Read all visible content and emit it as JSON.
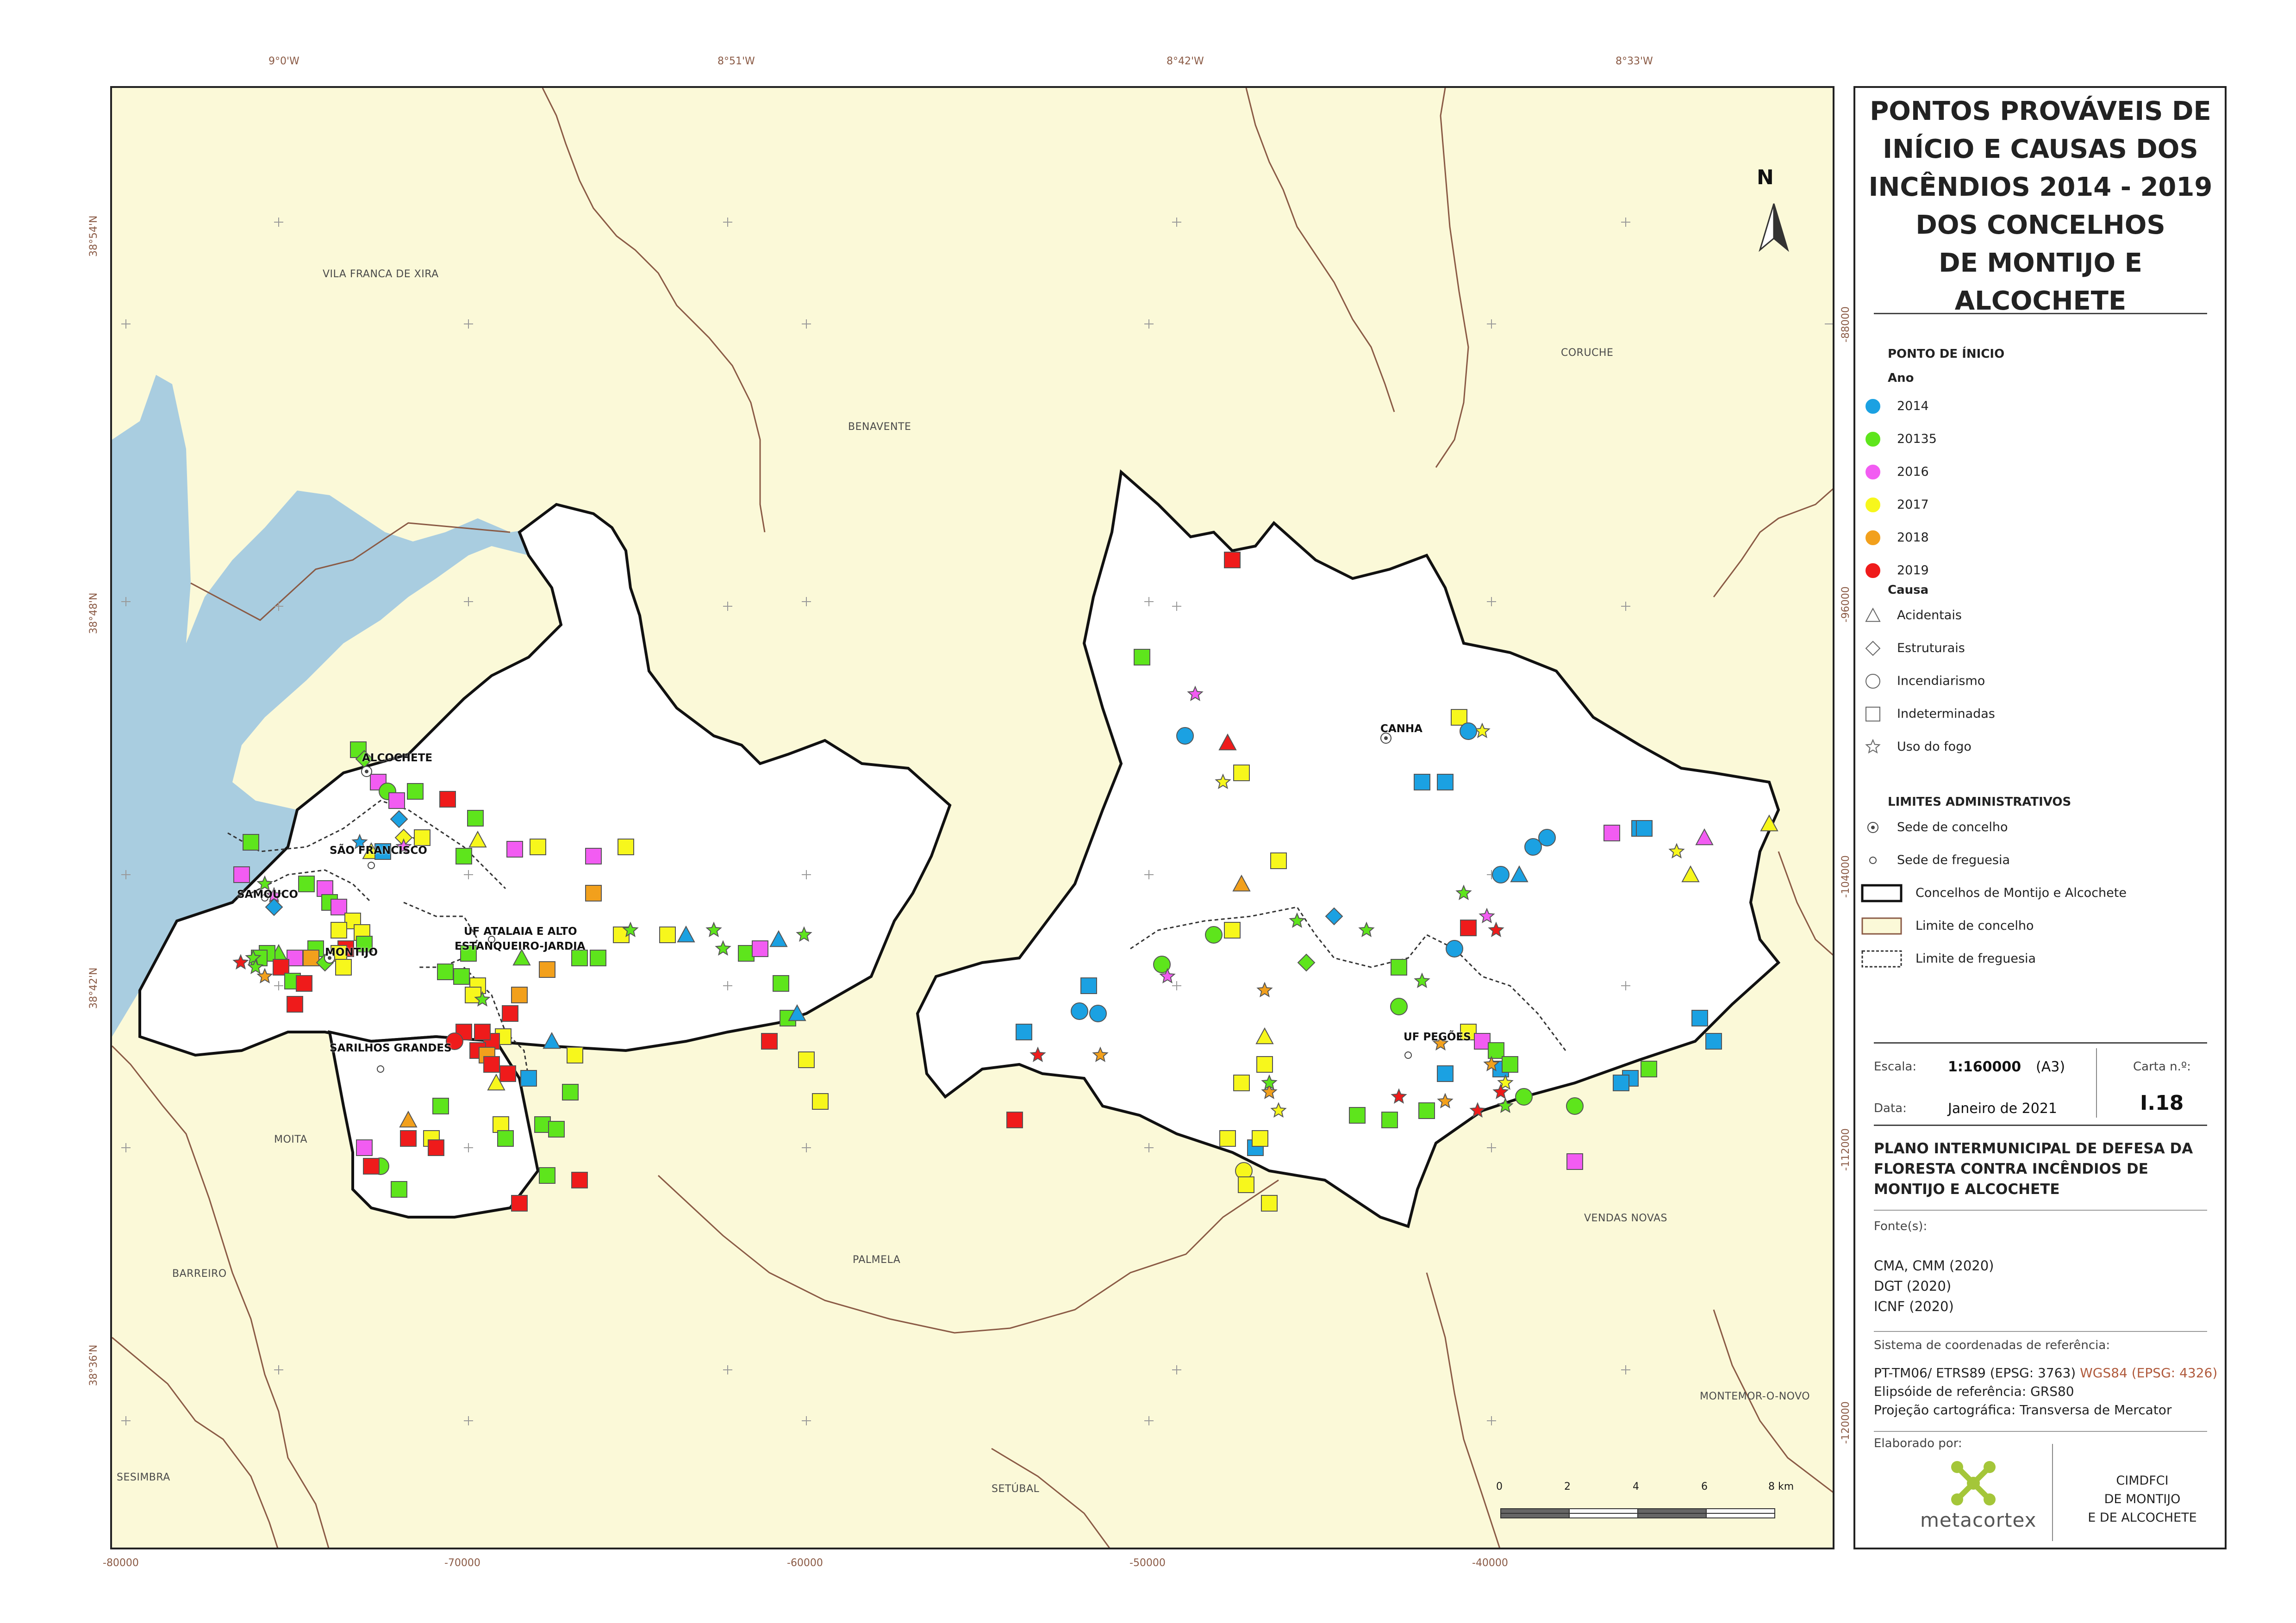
{
  "map": {
    "top_coords": [
      "9°0'W",
      "8°51'W",
      "8°42'W",
      "8°33'W"
    ],
    "bottom_coords": [
      "-80000",
      "-70000",
      "-60000",
      "-50000",
      "-40000"
    ],
    "left_coords": [
      "38°54'N",
      "38°48'N",
      "38°42'N",
      "38°36'N"
    ],
    "right_coords": [
      "-88000",
      "-96000",
      "-104000",
      "-112000",
      "-120000"
    ],
    "north": "N",
    "places": [
      "VILA FRANCA DE XIRA",
      "BENAVENTE",
      "CORUCHE",
      "MOITA",
      "BARREIRO",
      "PALMELA",
      "VENDAS NOVAS",
      "SESIMBRA",
      "SETÚBAL",
      "MONTEMOR-O-NOVO"
    ],
    "freguesias": [
      "ALCOCHETE",
      "SÃO FRANCISCO",
      "SAMOUCO",
      "MONTIJO",
      "UF ATALAIA E ALTO",
      "ESTANQUEIRO-JARDIA",
      "SARILHOS GRANDES",
      "CANHA",
      "UF PEGÕES"
    ],
    "scalebar_labels": [
      "0",
      "2",
      "4",
      "6",
      "8 km"
    ]
  },
  "panel": {
    "title_lines": [
      "PONTOS PROVÁVEIS DE",
      "INÍCIO E CAUSAS DOS",
      "INCÊNDIOS 2014 - 2019",
      "DOS CONCELHOS",
      "DE MONTIJO E",
      "ALCOCHETE"
    ],
    "legend_heading": "PONTO DE ÍNICIO",
    "ano_heading": "Ano",
    "years": [
      {
        "label": "2014",
        "color": "#1ba1e2"
      },
      {
        "label": "20135",
        "color": "#5ee51c"
      },
      {
        "label": "2016",
        "color": "#f25cf2"
      },
      {
        "label": "2017",
        "color": "#f7f71c"
      },
      {
        "label": "2018",
        "color": "#f2a01c"
      },
      {
        "label": "2019",
        "color": "#ef1b1b"
      }
    ],
    "causa_heading": "Causa",
    "causes": [
      {
        "label": "Acidentais",
        "icon": "triangle-icon"
      },
      {
        "label": "Estruturais",
        "icon": "diamond-icon"
      },
      {
        "label": "Incendiarismo",
        "icon": "circle-icon"
      },
      {
        "label": "Indeterminadas",
        "icon": "square-icon"
      },
      {
        "label": "Uso do fogo",
        "icon": "star-icon"
      }
    ],
    "limits_heading": "LIMITES ADMINISTRATIVOS",
    "limits": [
      {
        "label": "Sede de concelho",
        "icon": "dotted-circle-icon"
      },
      {
        "label": "Sede de freguesia",
        "icon": "small-circle-icon"
      },
      {
        "label": "Concelhos de Montijo e Alcochete",
        "icon": "bold-box-icon"
      },
      {
        "label": "Limite de concelho",
        "icon": "brown-box-icon"
      },
      {
        "label": "Limite de freguesia",
        "icon": "dashed-box-icon"
      }
    ],
    "escala_label": "Escala:",
    "escala_value": "1:160000",
    "paper": "(A3)",
    "carta_label": "Carta n.º:",
    "carta_value": "I.18",
    "data_label": "Data:",
    "data_value": "Janeiro de 2021",
    "plan_title": "PLANO INTERMUNICIPAL DE DEFESA DA FLORESTA CONTRA INCÊNDIOS DE MONTIJO E ALCOCHETE",
    "fontes_label": "Fonte(s):",
    "fontes": [
      "CMA, CMM (2020)",
      "DGT (2020)",
      "ICNF (2020)"
    ],
    "ref_label": "Sistema de coordenadas de referência:",
    "ref_1a": "PT-TM06/ ETRS89 (EPSG: 3763)",
    "ref_1b": "WGS84 (EPSG: 4326)",
    "ref_2": "Elipsóide de referência: GRS80",
    "ref_3": "Projeção cartográfica: Transversa de Mercator",
    "elaborado_label": "Elaborado por:",
    "logo_text": "metacortex",
    "client_lines": [
      "CIMDFCI",
      "DE MONTIJO",
      "E DE ALCOCHETE"
    ]
  }
}
